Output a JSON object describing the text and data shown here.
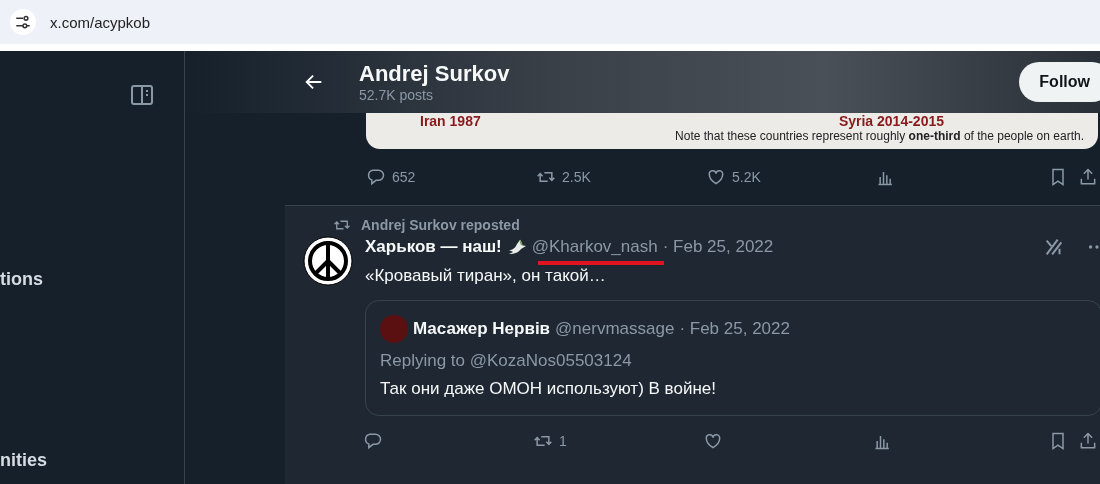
{
  "address_bar": {
    "url": "x.com/acypkob"
  },
  "sidebar": {
    "items": [
      {
        "label": "tions"
      },
      {
        "label": "nities"
      }
    ]
  },
  "header": {
    "name": "Andrej Surkov",
    "posts": "52.7K posts",
    "follow_button": "Follow"
  },
  "pinned_post": {
    "image": {
      "captions": [
        "Iran 1987",
        "Syria 2014-2015"
      ],
      "note": "Note that these countries represent roughly **one-third** of the people on earth."
    },
    "actions": [
      {
        "kind": "reply",
        "count": "652"
      },
      {
        "kind": "repost",
        "count": "2.5K"
      },
      {
        "kind": "like",
        "count": "5.2K"
      },
      {
        "kind": "views"
      },
      {
        "kind": "bookmark"
      },
      {
        "kind": "share"
      }
    ]
  },
  "repost": {
    "label": "Andrej Surkov reposted",
    "author": "Харьков — наш!",
    "handle": "@Kharkov_nash",
    "date": "· Feb 25, 2022",
    "text": "«Кровавый тиран», он такой…",
    "quote": {
      "author": "Масажер Нервів",
      "handle": "@nervmassage",
      "date": "· Feb 25, 2022",
      "replying": "Replying to @KozaNos05503124",
      "text": "Так они даже ОМОН используют) В войне!"
    },
    "actions": [
      {
        "kind": "reply"
      },
      {
        "kind": "repost",
        "count": "1"
      },
      {
        "kind": "like"
      },
      {
        "kind": "views"
      },
      {
        "kind": "bookmark"
      },
      {
        "kind": "share"
      }
    ]
  }
}
